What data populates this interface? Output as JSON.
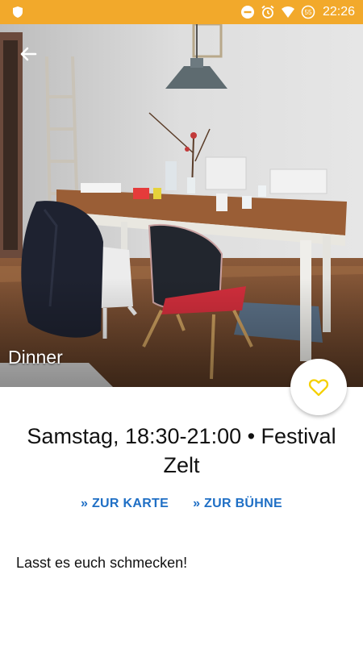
{
  "status_bar": {
    "time": "22:26",
    "badge": "55",
    "icons": [
      "shield-icon",
      "dnd-icon",
      "alarm-icon",
      "wifi-icon",
      "data-saver-icon"
    ],
    "color": "#f2a92b"
  },
  "hero": {
    "title": "Dinner",
    "back_icon": "arrow-back-icon"
  },
  "favorite": {
    "icon": "heart-outline-icon",
    "color": "#f5d000"
  },
  "event": {
    "time_line": "Samstag,  18:30-21:00 • Festival Zelt"
  },
  "links": {
    "map_label": "» ZUR KARTE",
    "stage_label": "» ZUR BÜHNE",
    "color": "#1f6fc5"
  },
  "description": "Lasst es euch schmecken!"
}
